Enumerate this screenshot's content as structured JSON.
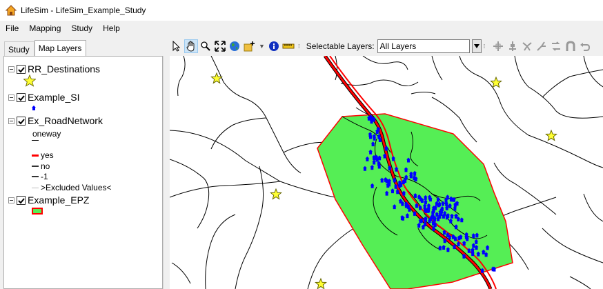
{
  "window": {
    "title": "LifeSim - LifeSim_Example_Study"
  },
  "menu": {
    "file": "File",
    "mapping": "Mapping",
    "study": "Study",
    "help": "Help"
  },
  "tabs": {
    "study": "Study",
    "map_layers": "Map Layers"
  },
  "layers": {
    "rr_destinations": {
      "name": "RR_Destinations",
      "icon": "yellow-star-icon",
      "color": "#ffff33"
    },
    "example_si": {
      "name": "Example_SI",
      "icon": "blue-house-icon",
      "color": "#0000ff"
    },
    "road_network": {
      "name": "Ex_RoadNetwork",
      "field": "oneway",
      "values": [
        {
          "label": "",
          "color": "#000000"
        },
        {
          "label": "yes",
          "color": "#ff0000"
        },
        {
          "label": "no",
          "color": "#333333"
        },
        {
          "label": "-1",
          "color": "#333333"
        },
        {
          "label": ">Excluded Values<",
          "color": "#bbbbbb"
        }
      ]
    },
    "example_epz": {
      "name": "Example_EPZ",
      "fill": "#55ee55",
      "outline": "#ff0000"
    }
  },
  "toolbar": {
    "selectable_label": "Selectable Layers:",
    "selectable_value": "All Layers",
    "tools": [
      "pointer-icon",
      "pan-hand-icon",
      "zoom-icon",
      "zoom-extent-icon",
      "globe-icon",
      "add-layer-icon",
      "identify-icon",
      "measure-icon"
    ],
    "edit_tools": [
      "add-node-icon",
      "move-node-icon",
      "split-icon",
      "merge-icon",
      "reverse-icon",
      "arch-icon",
      "undo-icon"
    ]
  },
  "map": {
    "background": "#ffffff",
    "epz_fill": "#55ee55",
    "epz_outline": "#ff0000",
    "road_oneway_color": "#ff0000",
    "structure_color": "#0000ff",
    "destination_color": "#ffff33"
  }
}
